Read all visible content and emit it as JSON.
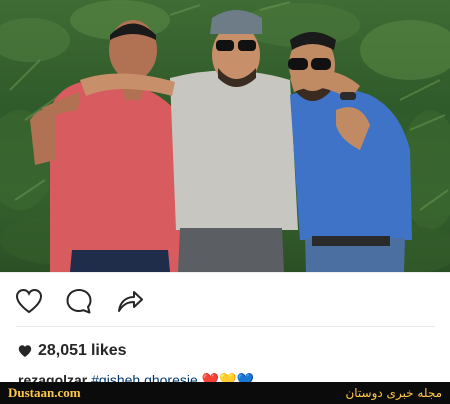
{
  "post": {
    "likes_count": "28,051",
    "likes_label": "likes",
    "caption_user": "rezagolzar",
    "caption_tag": "#gisheh ghoresie",
    "caption_emojis": "❤️💛💙"
  },
  "icons": {
    "like": "heart-outline-icon",
    "comment": "speech-bubble-icon",
    "share": "share-arrow-icon",
    "likes_heart": "filled-heart-icon"
  },
  "watermark": {
    "left": "Dustaan.com",
    "right": "مجله خبری دوستان"
  },
  "colors": {
    "text": "#262626",
    "watermark": "#ffc84a",
    "bar": "#0b0b0b"
  }
}
